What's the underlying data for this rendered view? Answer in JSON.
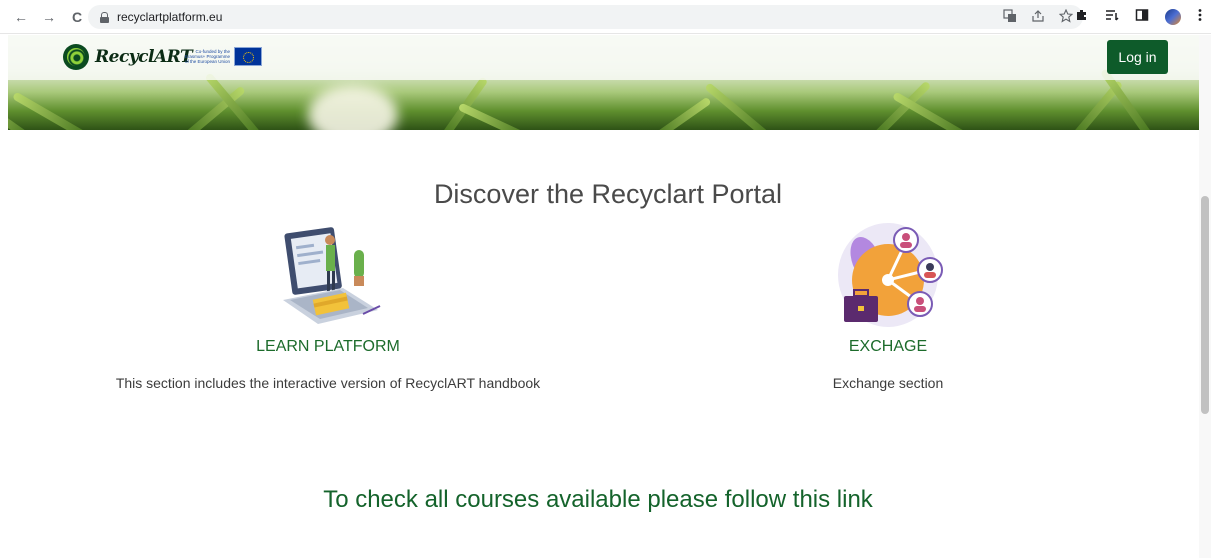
{
  "browser": {
    "url": "recyclartplatform.eu",
    "nav": {
      "back_icon": "←",
      "forward_icon": "→",
      "reload_icon": "C"
    },
    "omni_icons": [
      "translate-icon",
      "share-icon",
      "star-icon"
    ],
    "toolbar_icons": [
      "extensions-icon",
      "reading-list-icon",
      "side-panel-icon",
      "avatar",
      "menu-icon"
    ]
  },
  "header": {
    "logo_text": "RecyclART",
    "cofund_text": "Co-funded by the Erasmus+ Programme of the European Union",
    "login_label": "Log in",
    "accent_color": "#0e5b2a"
  },
  "main": {
    "title": "Discover the Recyclart Portal",
    "cards": [
      {
        "title": "LEARN PLATFORM",
        "description": "This section includes the interactive version of RecyclART handbook",
        "icon": "laptop-learning-illustration"
      },
      {
        "title": "EXCHAGE",
        "description": "Exchange section",
        "icon": "people-exchange-illustration"
      }
    ],
    "courses_link": "To check all courses available please follow this link",
    "link_color": "#14632b"
  }
}
